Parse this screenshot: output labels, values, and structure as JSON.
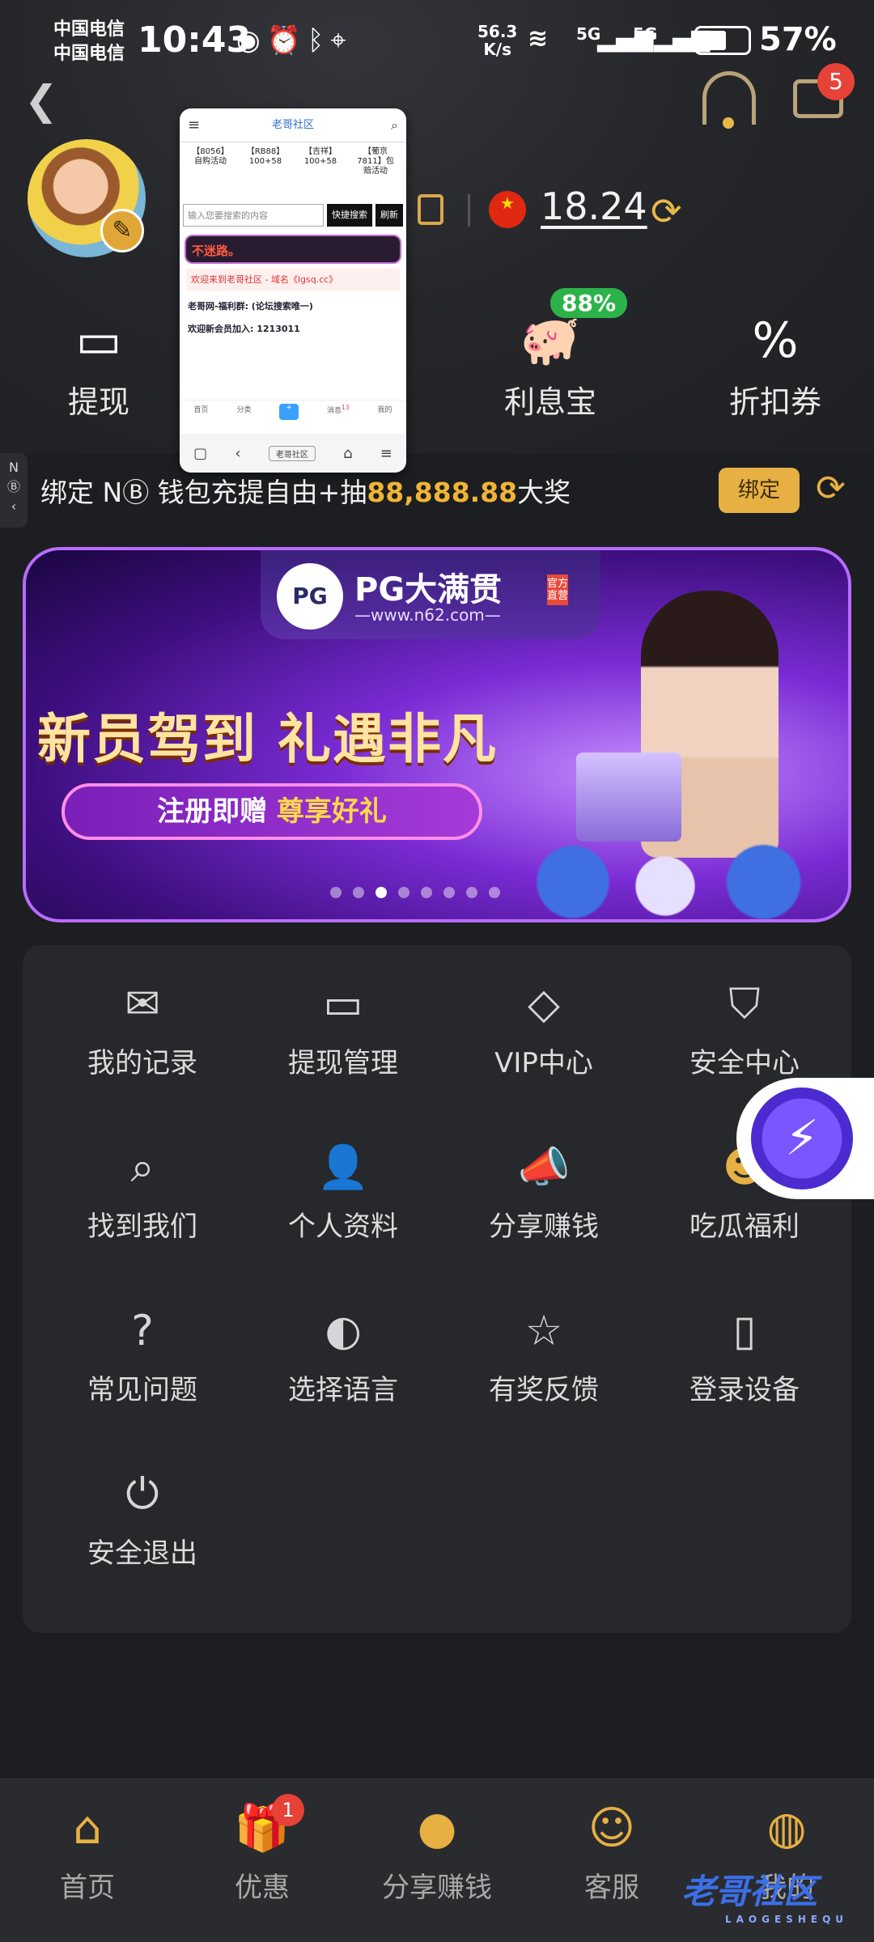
{
  "status_bar": {
    "carrier1": "中国电信",
    "carrier2": "中国电信",
    "time": "10:43",
    "net_speed": "56.3",
    "net_unit": "K/s",
    "sig1": "5G",
    "sig2": "5G",
    "battery": "57%",
    "battery_level": 0.57
  },
  "header": {
    "back_icon": "back-arrow-icon",
    "support_icon": "headset-icon",
    "mail_icon": "mail-icon",
    "mail_badge": "5"
  },
  "profile": {
    "balance": "18.24",
    "flag": "★"
  },
  "quick_actions": [
    {
      "label": "提现",
      "icon": "wallet-upload-icon"
    },
    {
      "label": "利息宝",
      "icon": "piggy-bank-icon",
      "badge": "88%"
    },
    {
      "label": "折扣券",
      "icon": "coupon-percent-icon"
    }
  ],
  "overlay": {
    "title": "老哥社区",
    "cats": [
      "【8056】自购活动",
      "【RB88】100+58",
      "【吉祥】100+58",
      "【葡京7811】包赔活动"
    ],
    "search_placeholder": "输入您要搜索的内容",
    "search_btn": "快捷搜索",
    "refresh_btn": "刷新",
    "red_text": "不迷路。",
    "notice": "欢迎来到老哥社区 - 域名《lgsq.cc》",
    "line1": "老哥网-福利群: (论坛搜索唯一)",
    "line2": "欢迎新会员加入: 1213011",
    "tabs": [
      "首页",
      "分类",
      "+",
      "消息",
      "我的"
    ],
    "tab_badge": "13",
    "address": "老哥社区"
  },
  "side_tab": {
    "text": "N"
  },
  "promo": {
    "text_before": "绑定 N",
    "text_mid": " 钱包充提自由+抽",
    "amount": "88,888.88",
    "text_after": "大奖",
    "bind_label": "绑定"
  },
  "banner": {
    "brand_logo": "PG",
    "brand_name": "PG大满贯",
    "brand_url": "—www.n62.com—",
    "official": "官方直营",
    "headline": "新员驾到 礼遇非凡",
    "sub_prefix": "注册即赠 ",
    "sub_highlight": "尊享好礼",
    "slide_count": 8,
    "active_slide": 3
  },
  "menu": [
    {
      "label": "我的记录",
      "icon": "record-inbox-icon"
    },
    {
      "label": "提现管理",
      "icon": "withdraw-card-icon"
    },
    {
      "label": "VIP中心",
      "icon": "vip-diamond-icon"
    },
    {
      "label": "安全中心",
      "icon": "security-shield-icon"
    },
    {
      "label": "找到我们",
      "icon": "find-search-icon"
    },
    {
      "label": "个人资料",
      "icon": "profile-card-icon"
    },
    {
      "label": "分享赚钱",
      "icon": "share-megaphone-icon"
    },
    {
      "label": "吃瓜福利",
      "icon": "gossip-mascot-icon"
    },
    {
      "label": "常见问题",
      "icon": "question-icon"
    },
    {
      "label": "选择语言",
      "icon": "language-globe-icon"
    },
    {
      "label": "有奖反馈",
      "icon": "feedback-star-icon"
    },
    {
      "label": "登录设备",
      "icon": "device-icon"
    },
    {
      "label": "安全退出",
      "icon": "power-icon"
    }
  ],
  "bottom_nav": [
    {
      "label": "首页",
      "icon": "home-icon"
    },
    {
      "label": "优惠",
      "icon": "gift-icon",
      "badge": "1"
    },
    {
      "label": "分享赚钱",
      "icon": "share-coin-icon"
    },
    {
      "label": "客服",
      "icon": "support-mascot-icon"
    },
    {
      "label": "我的",
      "icon": "profile-avatar-icon"
    }
  ],
  "watermark": {
    "text": "老哥社区",
    "sub": "LAOGESHEQU"
  },
  "colors": {
    "accent": "#e7b043",
    "background": "#1d1e22",
    "badge": "#e64238"
  }
}
